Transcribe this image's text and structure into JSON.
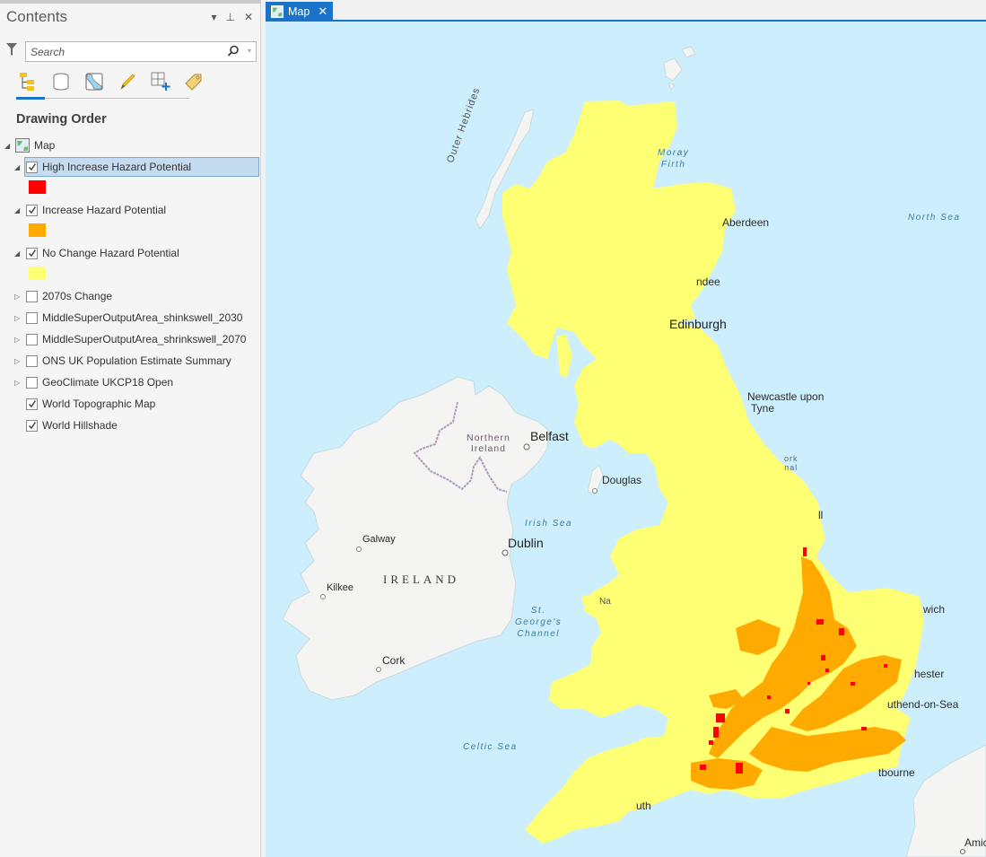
{
  "pane": {
    "title": "Contents",
    "controls": {
      "menu": "▾",
      "pin": "⊥",
      "close": "✕"
    },
    "search_placeholder": "Search",
    "section_title": "Drawing Order",
    "toolbar_icons": [
      "list-by-drawing-order-icon",
      "list-by-data-source-icon",
      "list-by-selection-icon",
      "list-by-editing-icon",
      "list-by-snapping-icon",
      "list-by-labeling-icon"
    ],
    "map_node": "Map",
    "layers": [
      {
        "label": "High Increase Hazard Potential",
        "checked": true,
        "expanded": true,
        "selected": true,
        "swatch": "#ff0000"
      },
      {
        "label": "Increase Hazard Potential",
        "checked": true,
        "expanded": true,
        "selected": false,
        "swatch": "#ffaa00"
      },
      {
        "label": "No Change Hazard Potential",
        "checked": true,
        "expanded": true,
        "selected": false,
        "swatch": "#ffff73"
      },
      {
        "label": "2070s Change",
        "checked": false,
        "expanded": false,
        "collapsible": true
      },
      {
        "label": "MiddleSuperOutputArea_shinkswell_2030",
        "checked": false,
        "expanded": false,
        "collapsible": true
      },
      {
        "label": "MiddleSuperOutputArea_shrinkswell_2070",
        "checked": false,
        "expanded": false,
        "collapsible": true
      },
      {
        "label": "ONS UK Population Estimate Summary",
        "checked": false,
        "expanded": false,
        "collapsible": true
      },
      {
        "label": "GeoClimate UKCP18 Open",
        "checked": false,
        "expanded": false,
        "collapsible": true
      },
      {
        "label": "World Topographic Map",
        "checked": true,
        "expanded": false,
        "collapsible": false
      },
      {
        "label": "World Hillshade",
        "checked": true,
        "expanded": false,
        "collapsible": false
      }
    ]
  },
  "map_tab": {
    "label": "Map",
    "close": "✕"
  },
  "colors": {
    "accent": "#1a73c8",
    "sea": "#cdeefc",
    "land": "#f4f4f2",
    "no_change": "#ffff73",
    "increase": "#ffaa00",
    "high_increase": "#ff0000"
  },
  "map_labels": {
    "cities": [
      {
        "name": "Aberdeen"
      },
      {
        "name": "Dundee",
        "partial": "ndee"
      },
      {
        "name": "Edinburgh"
      },
      {
        "name": "Newcastle upon Tyne",
        "line1": "Newcastle upon",
        "line2": "Tyne"
      },
      {
        "name": "Belfast"
      },
      {
        "name": "Douglas"
      },
      {
        "name": "Dublin"
      },
      {
        "name": "Galway"
      },
      {
        "name": "Kilkee"
      },
      {
        "name": "Cork"
      },
      {
        "name": "Norwich",
        "partial": "wich"
      },
      {
        "name": "Colchester",
        "partial": "hester"
      },
      {
        "name": "Southend-on-Sea",
        "partial": "uthend-on-Sea"
      },
      {
        "name": "Eastbourne",
        "partial": "tbourne"
      },
      {
        "name": "Plymouth",
        "partial": "uth"
      },
      {
        "name": "Amiens",
        "partial": "Amic"
      },
      {
        "name": "Hull",
        "partial": "ll"
      },
      {
        "name": "Narberth",
        "partial": "Na"
      }
    ],
    "seas": {
      "moray_firth": [
        "Moray",
        "Firth"
      ],
      "north_sea": "North Sea",
      "irish_sea": "Irish Sea",
      "st_georges_channel": [
        "St.",
        "George's",
        "Channel"
      ],
      "celtic_sea": "Celtic Sea"
    },
    "regions": {
      "outer_hebrides": "Outer Hebrides",
      "northern_ireland": [
        "Northern",
        "Ireland"
      ],
      "ireland": "IRELAND",
      "north_york_moors": [
        "ork",
        "nal"
      ]
    }
  }
}
